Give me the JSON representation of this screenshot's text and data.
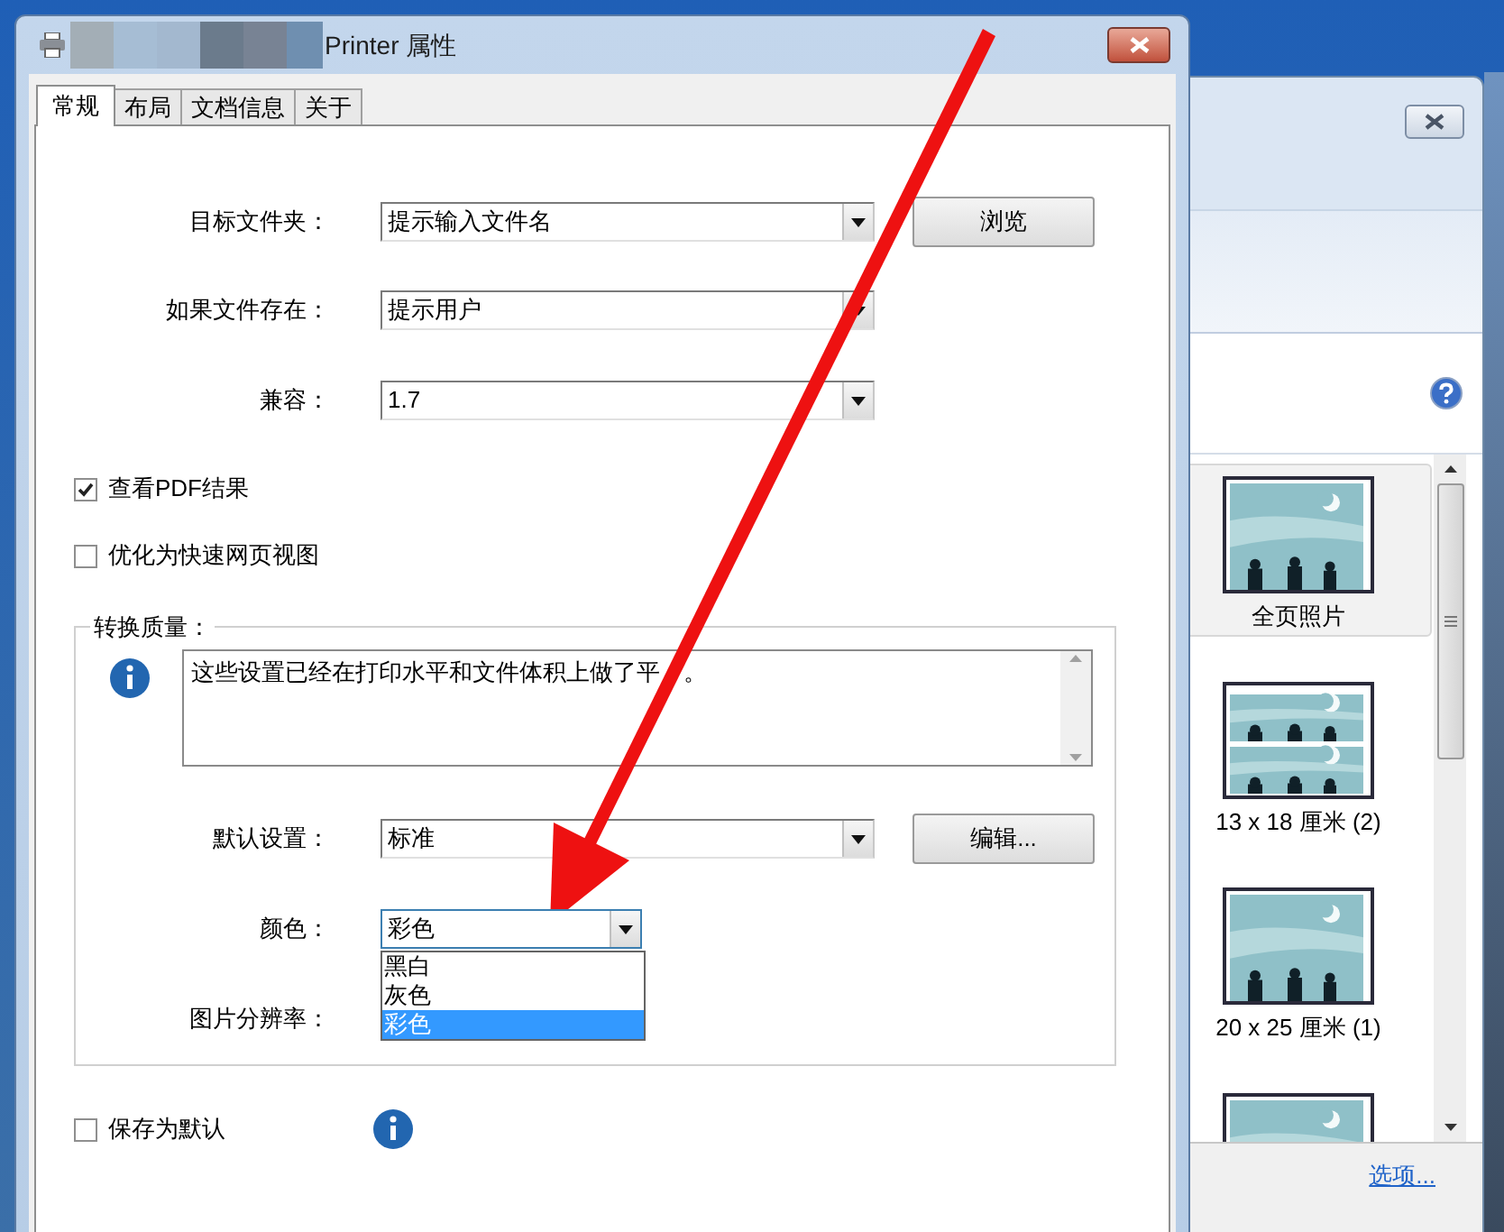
{
  "window": {
    "title": "Printer 属性"
  },
  "tabs": [
    {
      "label": "常规",
      "selected": true
    },
    {
      "label": "布局",
      "selected": false
    },
    {
      "label": "文档信息",
      "selected": false
    },
    {
      "label": "关于",
      "selected": false
    }
  ],
  "fields": [
    {
      "label": "目标文件夹：",
      "value": "提示输入文件名",
      "button": "浏览"
    },
    {
      "label": "如果文件存在：",
      "value": "提示用户"
    },
    {
      "label": "兼容：",
      "value": "1.7"
    }
  ],
  "checkboxes": [
    {
      "label": "查看PDF结果",
      "checked": true
    },
    {
      "label": "优化为快速网页视图",
      "checked": false
    }
  ],
  "quality": {
    "title": "转换质量：",
    "description": "这些设置已经在打印水平和文件体积上做了平",
    "description_end": "。",
    "default_setting": {
      "label": "默认设置：",
      "value": "标准",
      "button": "编辑..."
    },
    "color": {
      "label": "颜色：",
      "value": "彩色",
      "expanded": true,
      "options": [
        {
          "label": "黑白",
          "selected": false
        },
        {
          "label": "灰色",
          "selected": false
        },
        {
          "label": "彩色",
          "selected": true
        }
      ]
    },
    "resolution": {
      "label": "图片分辨率："
    }
  },
  "save_default": {
    "label": "保存为默认",
    "checked": false
  },
  "background_window": {
    "layouts": [
      {
        "label": "全页照片",
        "selected": true,
        "kind": "single"
      },
      {
        "label": "13 x 18 厘米 (2)",
        "selected": false,
        "kind": "double"
      },
      {
        "label": "20 x 25 厘米 (1)",
        "selected": false,
        "kind": "single"
      },
      {
        "selected": false,
        "kind": "single"
      }
    ],
    "options_link": "选项..."
  }
}
